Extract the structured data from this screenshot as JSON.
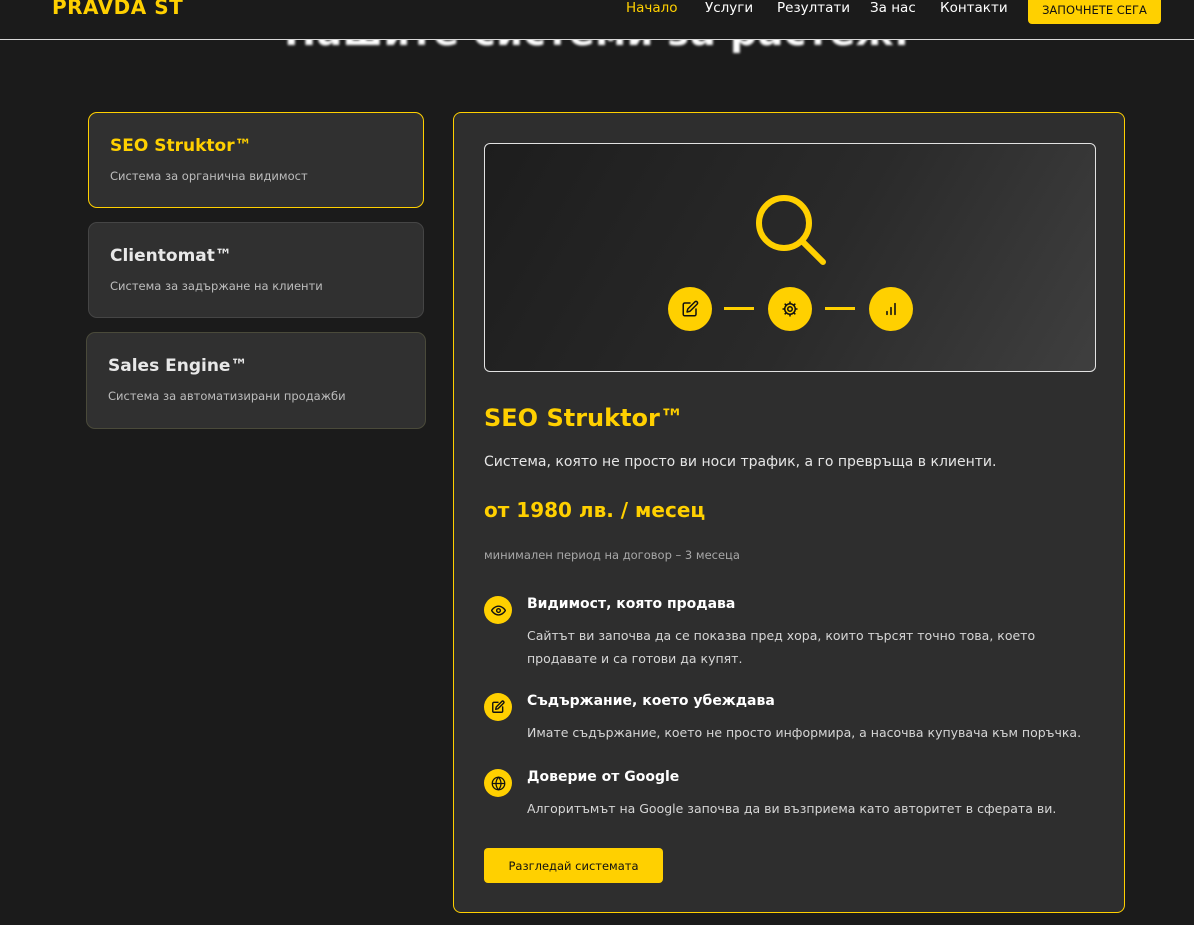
{
  "brand": {
    "logo": "PRAVDA ST",
    "accent": "#ffd000"
  },
  "nav": {
    "items": [
      {
        "label": "Начало",
        "active": true
      },
      {
        "label": "Услуги",
        "active": false
      },
      {
        "label": "Резултати",
        "active": false
      },
      {
        "label": "За нас",
        "active": false
      },
      {
        "label": "Контакти",
        "active": false
      }
    ],
    "cta_label": "ЗАПОЧНЕТЕ СЕГА"
  },
  "section": {
    "title": "Нашите системи за растеж:"
  },
  "tabs": [
    {
      "title": "SEO Struktor™",
      "subtitle": "Система за органична видимост",
      "active": true
    },
    {
      "title": "Clientomat™",
      "subtitle": "Система за задържане на клиенти",
      "active": false
    },
    {
      "title": "Sales Engine™",
      "subtitle": "Система за автоматизирани продажби",
      "active": false
    }
  ],
  "panel": {
    "visual_icons": [
      "search-icon",
      "edit-icon",
      "gear-icon",
      "bar-chart-icon"
    ],
    "title": "SEO Struktor™",
    "description": "Система, която не просто ви носи трафик, а го превръща в клиенти.",
    "price": "от 1980 лв. / месец",
    "note": "минимален период на договор – 3 месеца",
    "features": [
      {
        "icon": "eye-icon",
        "title": "Видимост, която продава",
        "text": "Сайтът ви започва да се показва пред хора, които търсят точно това, което продавате и са готови да купят."
      },
      {
        "icon": "edit-icon",
        "title": "Съдържание, което убеждава",
        "text": "Имате съдържание, което не просто информира, а насочва купувача към поръчка."
      },
      {
        "icon": "globe-icon",
        "title": "Доверие от Google",
        "text": "Алгоритъмът на Google започва да ви възприема като авторитет в сферата ви."
      }
    ],
    "cta_label": "Разгледай системата"
  }
}
